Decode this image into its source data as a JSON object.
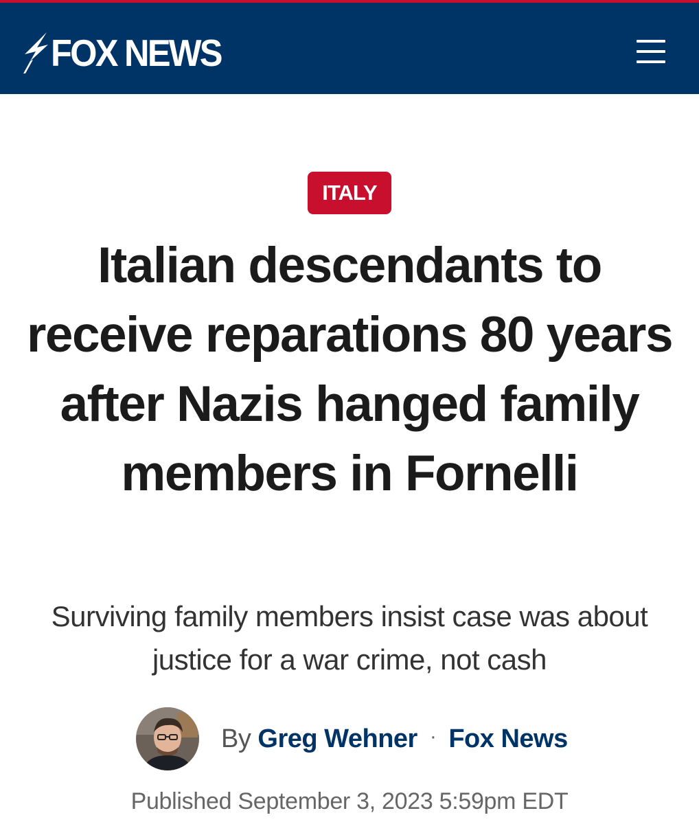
{
  "header": {
    "logo_text": "FOX NEWS",
    "menu_icon": "hamburger-menu-icon"
  },
  "article": {
    "category": "ITALY",
    "headline": "Italian descendants to receive reparations 80 years after Nazis hanged family members in Fornelli",
    "subheadline": "Surviving family members insist case was about justice for a war crime, not cash",
    "byline": {
      "prefix": "By",
      "author": "Greg Wehner",
      "separator": "·",
      "outlet": "Fox News"
    },
    "published": "Published September 3, 2023 5:59pm EDT"
  },
  "colors": {
    "header_bg": "#003366",
    "accent_red": "#c8102e",
    "link_blue": "#003366",
    "headline_text": "#1b1b1b"
  }
}
